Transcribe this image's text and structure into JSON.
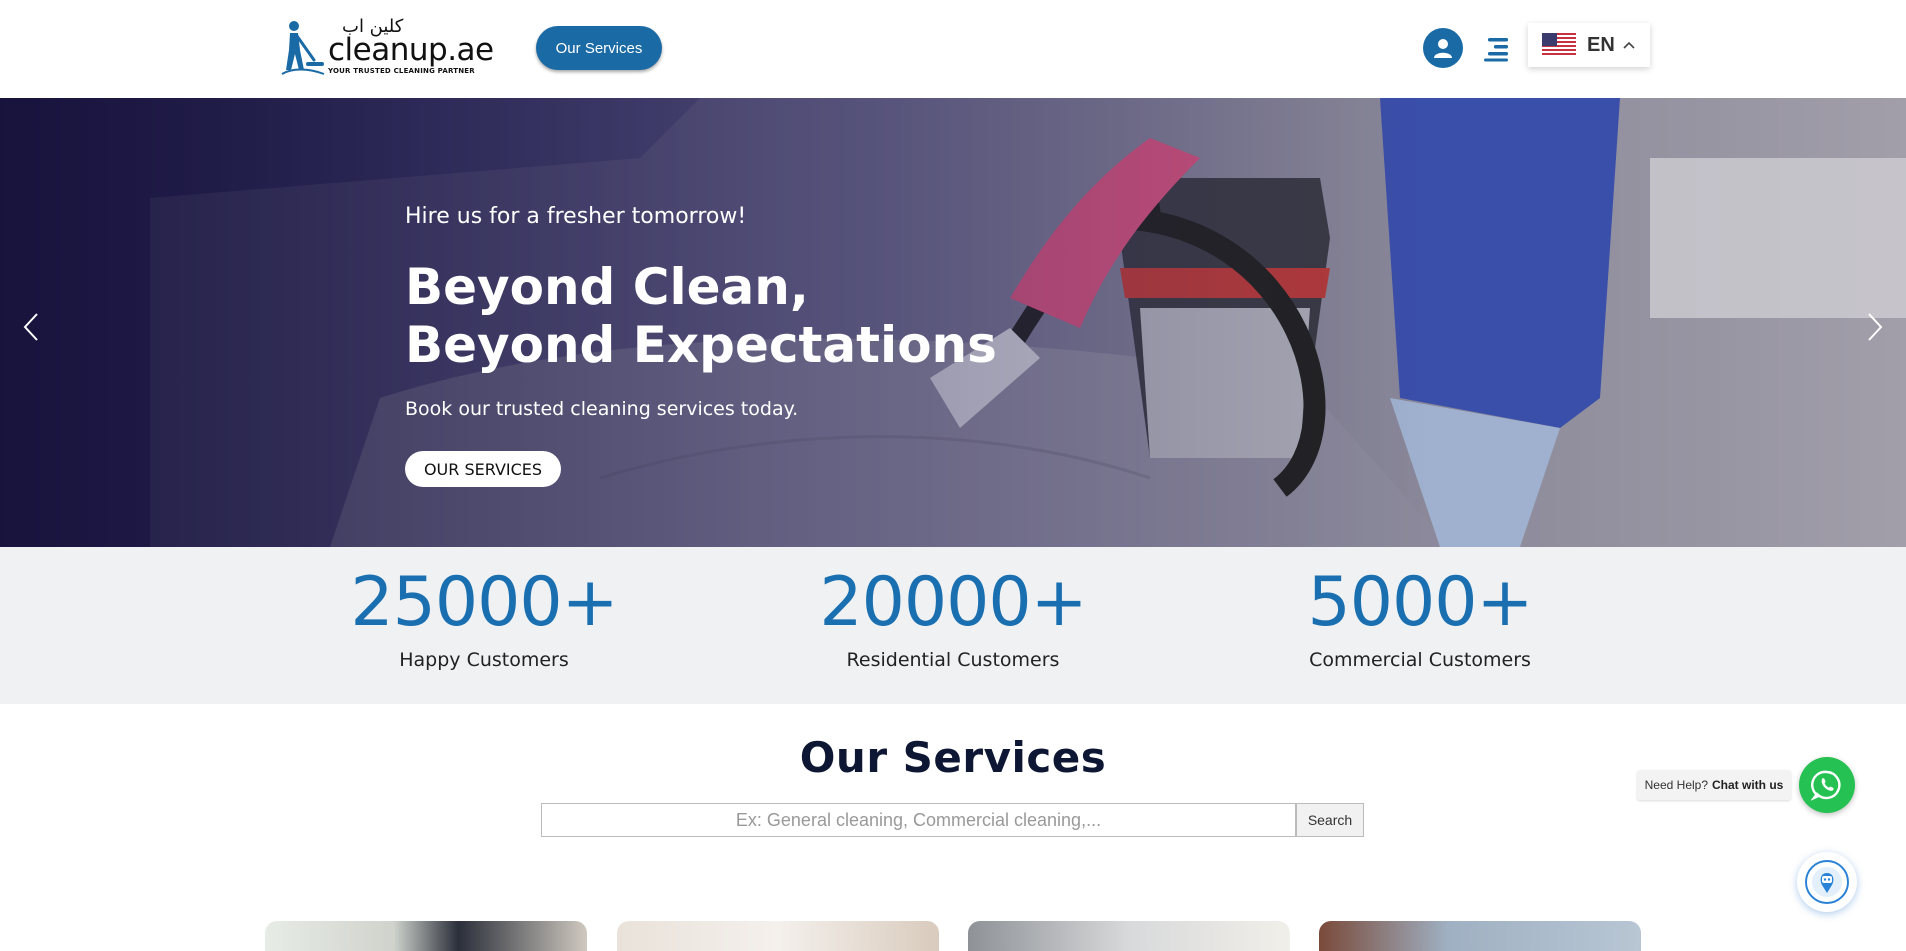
{
  "header": {
    "logo_text": "cleanup.ae",
    "logo_arabic": "كلين اب",
    "logo_tagline": "YOUR TRUSTED CLEANING PARTNER",
    "services_button": "Our Services",
    "language_code": "EN",
    "icons": [
      "user-icon",
      "menu-icon",
      "us-flag-icon",
      "chevron-up-icon"
    ]
  },
  "hero": {
    "eyebrow": "Hire us for a fresher tomorrow!",
    "title_line1": "Beyond Clean,",
    "title_line2": "Beyond Expectations",
    "subtitle": "Book our trusted cleaning services today.",
    "button": "OUR SERVICES",
    "icons": [
      "chevron-left-icon",
      "chevron-right-icon"
    ]
  },
  "stats": [
    {
      "number": "25000+",
      "label": "Happy Customers"
    },
    {
      "number": "20000+",
      "label": "Residential Customers"
    },
    {
      "number": "5000+",
      "label": "Commercial Customers"
    }
  ],
  "services": {
    "title": "Our Services",
    "search_placeholder": "Ex: General cleaning, Commercial cleaning,...",
    "search_value": "",
    "search_button": "Search"
  },
  "chat": {
    "help_prefix": "Need Help?",
    "help_link": "Chat with us",
    "icons": [
      "whatsapp-icon",
      "chatbot-icon"
    ]
  },
  "colors": {
    "brand_blue": "#1a6aa5",
    "stat_blue": "#1a6fb0",
    "whatsapp_green": "#25c152",
    "heading_navy": "#0d1633"
  }
}
